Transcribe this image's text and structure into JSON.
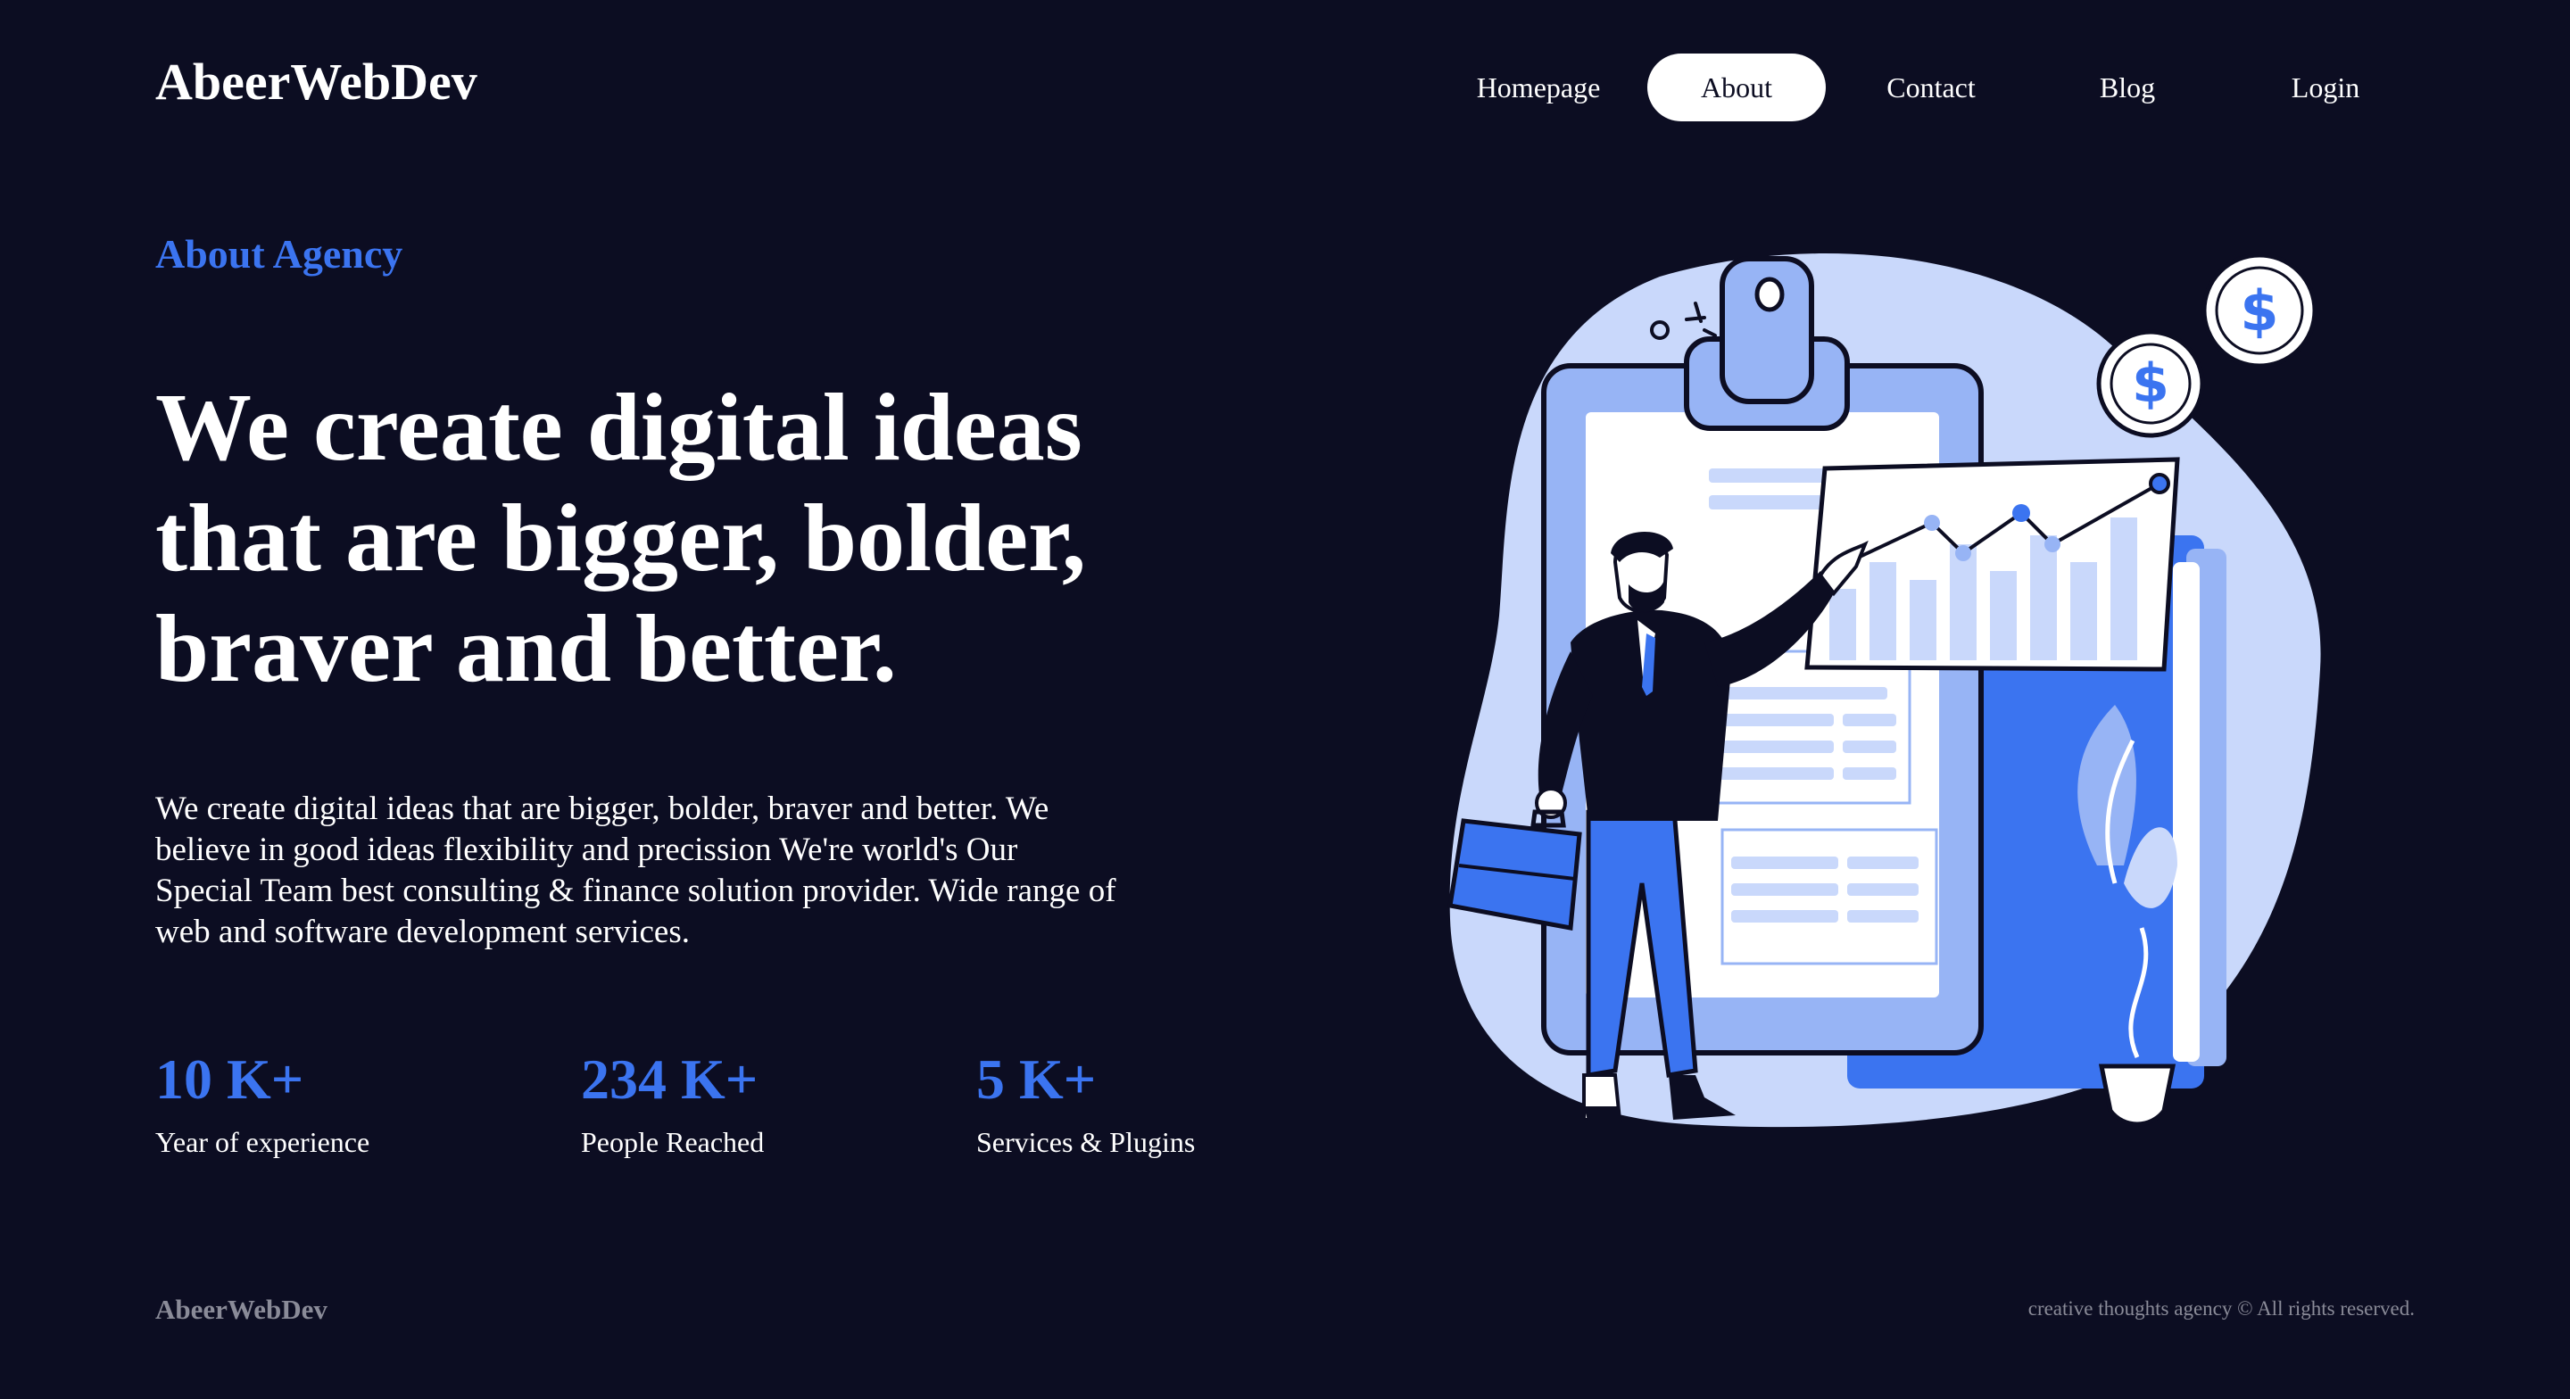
{
  "header": {
    "logo": "AbeerWebDev",
    "nav": [
      {
        "label": "Homepage",
        "active": false
      },
      {
        "label": "About",
        "active": true
      },
      {
        "label": "Contact",
        "active": false
      },
      {
        "label": "Blog",
        "active": false
      },
      {
        "label": "Login",
        "active": false
      }
    ]
  },
  "hero": {
    "eyebrow": "About Agency",
    "headline_lines": [
      "We create digital ideas",
      "that are bigger, bolder,",
      "braver and better."
    ],
    "description_lines": [
      "We create digital ideas that are bigger, bolder, braver and better. We",
      "believe in good ideas flexibility and precission We're world's Our",
      "Special Team best consulting & finance solution provider. Wide range of",
      "web and software development services."
    ]
  },
  "stats": [
    {
      "value": "10 K+",
      "label": "Year of experience"
    },
    {
      "value": "234 K+",
      "label": "People Reached"
    },
    {
      "value": "5 K+",
      "label": "Services & Plugins"
    }
  ],
  "illustration": {
    "icon": "business-presentation-illustration",
    "coin_symbol": "$"
  },
  "footer": {
    "logo": "AbeerWebDev",
    "copyright": "creative thoughts agency © All rights reserved."
  },
  "colors": {
    "background": "#0c0d22",
    "accent": "#3b74f0",
    "muted": "#8a8b98",
    "light_blue": "#c9d8fb",
    "mid_blue": "#97b4f5"
  }
}
